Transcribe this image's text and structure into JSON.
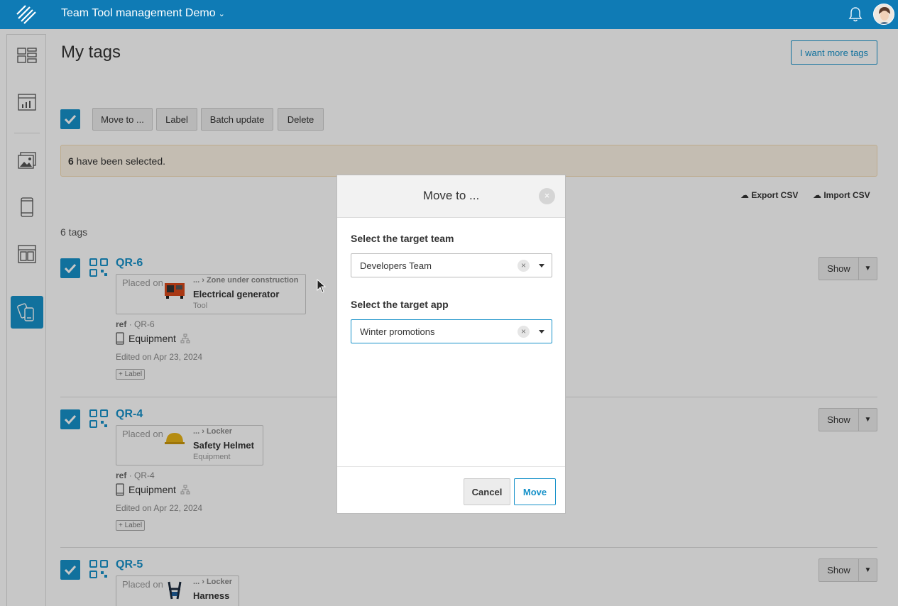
{
  "header": {
    "app_title": "Team Tool management Demo",
    "caret": "⌄"
  },
  "sidebar": {
    "items": [
      {
        "icon": "dashboard-icon"
      },
      {
        "icon": "stats-icon"
      },
      {
        "icon": "gallery-icon"
      },
      {
        "icon": "mobile-icon"
      },
      {
        "icon": "layout-icon"
      },
      {
        "icon": "tags-icon",
        "active": true
      }
    ]
  },
  "page": {
    "title": "My tags",
    "more_tags_label": "I want more tags",
    "toolbar": {
      "move_label": "Move to ...",
      "label_label": "Label",
      "batch_label": "Batch update",
      "delete_label": "Delete"
    },
    "selection_count": "6",
    "selection_text": " have been selected.",
    "export_csv": "Export CSV",
    "import_csv": "Import CSV",
    "tags_count": "6 tags"
  },
  "tags": [
    {
      "name": "QR-6",
      "placed_on": "Placed on",
      "location": "... › Zone under construction",
      "object": "Electrical generator",
      "kind": "Tool",
      "ref": "ref",
      "ref_value": "· QR-6",
      "equipment": "Equipment",
      "edited": "Edited on Apr 23, 2024",
      "label_btn": "+ Label",
      "show": "Show"
    },
    {
      "name": "QR-4",
      "placed_on": "Placed on",
      "location": "... › Locker",
      "object": "Safety Helmet",
      "kind": "Equipment",
      "ref": "ref",
      "ref_value": "· QR-4",
      "equipment": "Equipment",
      "edited": "Edited on Apr 22, 2024",
      "label_btn": "+ Label",
      "show": "Show"
    },
    {
      "name": "QR-5",
      "placed_on": "Placed on",
      "location": "... › Locker",
      "object": "Harness",
      "kind": "",
      "show": "Show"
    }
  ],
  "modal": {
    "title": "Move to ...",
    "close": "×",
    "team_label": "Select the target team",
    "team_value": "Developers Team",
    "app_label": "Select the target app",
    "app_value": "Winter promotions",
    "clear": "×",
    "cancel": "Cancel",
    "move": "Move"
  },
  "colors": {
    "brand": "#0f7bb5",
    "accent": "#1691c9",
    "warning_bg": "#fcf3e4"
  }
}
